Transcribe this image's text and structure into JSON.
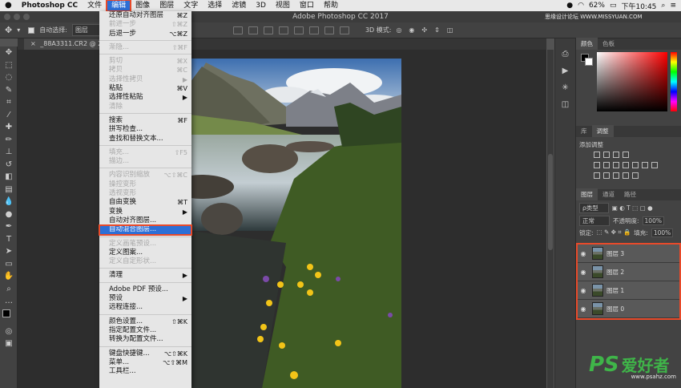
{
  "menubar": {
    "apple": "",
    "app_name": "Photoshop CC",
    "items": [
      "文件",
      "编辑",
      "图像",
      "图层",
      "文字",
      "选择",
      "滤镜",
      "3D",
      "视图",
      "窗口",
      "帮助"
    ],
    "battery": "62%",
    "clock": "下午10:45"
  },
  "window": {
    "title": "Adobe Photoshop CC 2017"
  },
  "options": {
    "auto_select_label": "自动选择:",
    "auto_select_value": "图层",
    "mode_3d_label": "3D 模式:"
  },
  "document": {
    "tab_title": "_88A3311.CR2 @ 20.6%("
  },
  "edit_menu": {
    "items": [
      {
        "label": "还原自动对齐图层",
        "shortcut": "⌘Z",
        "disabled": false
      },
      {
        "label": "前进一步",
        "shortcut": "⇧⌘Z",
        "disabled": true
      },
      {
        "label": "后退一步",
        "shortcut": "⌥⌘Z",
        "disabled": false
      },
      {
        "sep": true
      },
      {
        "label": "渐隐...",
        "shortcut": "⇧⌘F",
        "disabled": true
      },
      {
        "sep": true
      },
      {
        "label": "剪切",
        "shortcut": "⌘X",
        "disabled": true
      },
      {
        "label": "拷贝",
        "shortcut": "⌘C",
        "disabled": true
      },
      {
        "label": "选择性拷贝",
        "shortcut": "▶",
        "disabled": true
      },
      {
        "label": "粘贴",
        "shortcut": "⌘V",
        "disabled": false
      },
      {
        "label": "选择性粘贴",
        "shortcut": "▶",
        "disabled": false
      },
      {
        "label": "清除",
        "shortcut": "",
        "disabled": true
      },
      {
        "sep": true
      },
      {
        "label": "搜索",
        "shortcut": "⌘F",
        "disabled": false
      },
      {
        "label": "拼写检查...",
        "shortcut": "",
        "disabled": false
      },
      {
        "label": "查找和替换文本...",
        "shortcut": "",
        "disabled": false
      },
      {
        "sep": true
      },
      {
        "label": "填充...",
        "shortcut": "⇧F5",
        "disabled": true
      },
      {
        "label": "描边...",
        "shortcut": "",
        "disabled": true
      },
      {
        "sep": true
      },
      {
        "label": "内容识别缩放",
        "shortcut": "⌥⇧⌘C",
        "disabled": true
      },
      {
        "label": "操控变形",
        "shortcut": "",
        "disabled": true
      },
      {
        "label": "透视变形",
        "shortcut": "",
        "disabled": true
      },
      {
        "label": "自由变换",
        "shortcut": "⌘T",
        "disabled": false
      },
      {
        "label": "变换",
        "shortcut": "▶",
        "disabled": false
      },
      {
        "label": "自动对齐图层...",
        "shortcut": "",
        "disabled": false
      },
      {
        "label": "自动混合图层...",
        "shortcut": "",
        "disabled": false,
        "highlight": true
      },
      {
        "sep": true
      },
      {
        "label": "定义画笔预设...",
        "shortcut": "",
        "disabled": true
      },
      {
        "label": "定义图案...",
        "shortcut": "",
        "disabled": false
      },
      {
        "label": "定义自定形状...",
        "shortcut": "",
        "disabled": true
      },
      {
        "sep": true
      },
      {
        "label": "清理",
        "shortcut": "▶",
        "disabled": false
      },
      {
        "sep": true
      },
      {
        "label": "Adobe PDF 预设...",
        "shortcut": "",
        "disabled": false
      },
      {
        "label": "预设",
        "shortcut": "▶",
        "disabled": false
      },
      {
        "label": "远程连接...",
        "shortcut": "",
        "disabled": false
      },
      {
        "sep": true
      },
      {
        "label": "颜色设置...",
        "shortcut": "⇧⌘K",
        "disabled": false
      },
      {
        "label": "指定配置文件...",
        "shortcut": "",
        "disabled": false
      },
      {
        "label": "转换为配置文件...",
        "shortcut": "",
        "disabled": false
      },
      {
        "sep": true
      },
      {
        "label": "键盘快捷键...",
        "shortcut": "⌥⇧⌘K",
        "disabled": false
      },
      {
        "label": "菜单...",
        "shortcut": "⌥⇧⌘M",
        "disabled": false
      },
      {
        "label": "工具栏...",
        "shortcut": "",
        "disabled": false
      }
    ]
  },
  "color_panel": {
    "tabs": [
      "颜色",
      "色板"
    ]
  },
  "adjust_panel": {
    "tabs": [
      "库",
      "调整"
    ],
    "add_label": "添加调整"
  },
  "layers_panel": {
    "tabs": [
      "图层",
      "通道",
      "路径"
    ],
    "filter_label": "ρ类型",
    "blend_mode": "正常",
    "opacity_label": "不透明度:",
    "opacity_value": "100%",
    "lock_label": "锁定:",
    "fill_label": "填充:",
    "fill_value": "100%",
    "layers": [
      "图层 3",
      "图层 2",
      "图层 1",
      "图层 0"
    ]
  },
  "watermark": {
    "logo": "PS",
    "text": "爱好者",
    "url": "www.psahz.com"
  },
  "top_url_watermark": "思缘设计论坛 WWW.MISSYUAN.COM",
  "colors": {
    "menu_highlight": "#2d6fd6",
    "annotation_red": "#e84a2a"
  }
}
